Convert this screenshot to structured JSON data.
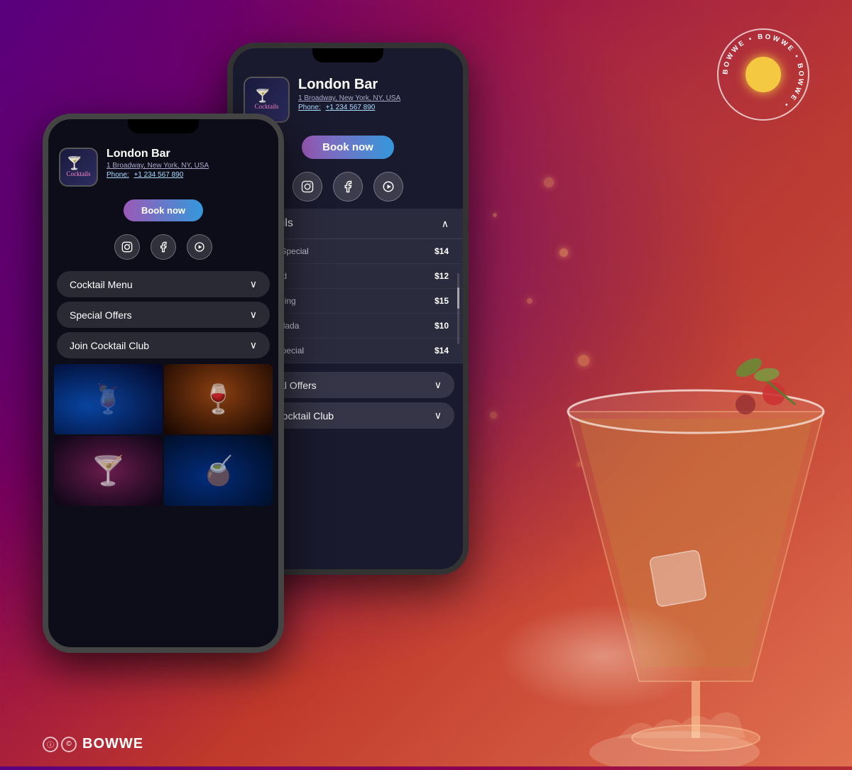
{
  "background": {
    "gradient_from": "#5a0080",
    "gradient_to": "#e07050"
  },
  "bowwe_logo": {
    "text": "BOWWE • BOWWE • BOWWE •",
    "alt": "BOWWE circular logo"
  },
  "footer": {
    "brand_name": "BOWWE",
    "copyright_label": "©"
  },
  "back_phone": {
    "bar_name": "London Bar",
    "address": "1 Broadway, New York, NY, USA",
    "phone_label": "Phone:",
    "phone_number": "+1 234 567 890",
    "book_now": "Book now",
    "social": {
      "instagram": "instagram",
      "facebook": "facebook",
      "youtube": "youtube"
    },
    "cocktails_section": {
      "title": "Cocktails",
      "items": [
        {
          "name": "ns Night Special",
          "price": "$14"
        },
        {
          "name": "Fashioned",
          "price": "$12"
        },
        {
          "name": "oshima Sling",
          "price": "$15"
        },
        {
          "name": "nchito Colada",
          "price": "$10"
        },
        {
          "name": "ns Day Special",
          "price": "$14"
        }
      ]
    },
    "menu_items": [
      {
        "label": "Special Offers",
        "icon": "chevron-down"
      },
      {
        "label": "Join Cocktail Club",
        "icon": "chevron-down"
      }
    ]
  },
  "front_phone": {
    "bar_name": "London Bar",
    "address": "1 Broadway, New York, NY, USA",
    "phone_label": "Phone:",
    "phone_number": "+1 234 567 890",
    "book_now": "Book now",
    "social": {
      "instagram": "instagram",
      "facebook": "facebook",
      "youtube": "youtube"
    },
    "menu_items": [
      {
        "label": "Cocktail Menu",
        "icon": "chevron-down"
      },
      {
        "label": "Special Offers",
        "icon": "chevron-down"
      },
      {
        "label": "Join Cocktail Club",
        "icon": "chevron-down"
      }
    ],
    "photos": [
      {
        "alt": "blue cocktail",
        "emoji": "🍹"
      },
      {
        "alt": "orange wine glass",
        "emoji": "🍷"
      },
      {
        "alt": "pink cocktail",
        "emoji": "🍸"
      },
      {
        "alt": "blue tropical cocktail",
        "emoji": "🧉"
      }
    ]
  }
}
